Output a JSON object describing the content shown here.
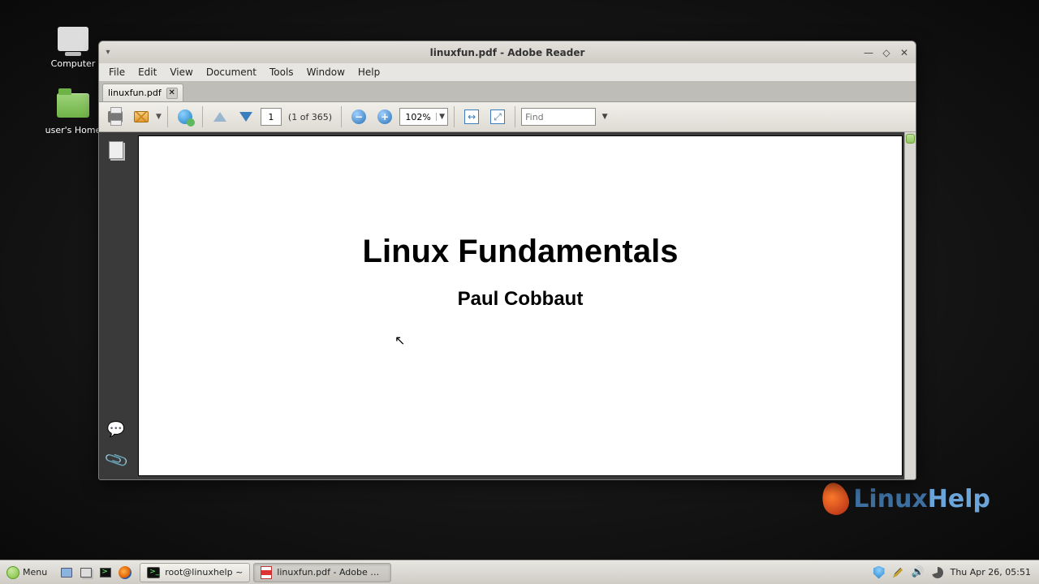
{
  "desktop": {
    "icons": {
      "computer": "Computer",
      "home": "user's Home"
    },
    "watermark": {
      "brand1": "Linux",
      "brand2": "Help"
    }
  },
  "window": {
    "title": "linuxfun.pdf - Adobe Reader",
    "menubar": [
      "File",
      "Edit",
      "View",
      "Document",
      "Tools",
      "Window",
      "Help"
    ],
    "tab": {
      "label": "linuxfun.pdf"
    },
    "toolbar": {
      "page_current": "1",
      "page_label": "(1 of 365)",
      "zoom": "102%",
      "find_placeholder": "Find"
    },
    "document": {
      "title": "Linux Fundamentals",
      "author": "Paul Cobbaut"
    }
  },
  "taskbar": {
    "menu": "Menu",
    "tasks": [
      {
        "label": "root@linuxhelp ~",
        "kind": "terminal",
        "active": false
      },
      {
        "label": "linuxfun.pdf - Adobe R...",
        "kind": "pdf",
        "active": true
      }
    ],
    "clock": "Thu Apr 26, 05:51"
  }
}
